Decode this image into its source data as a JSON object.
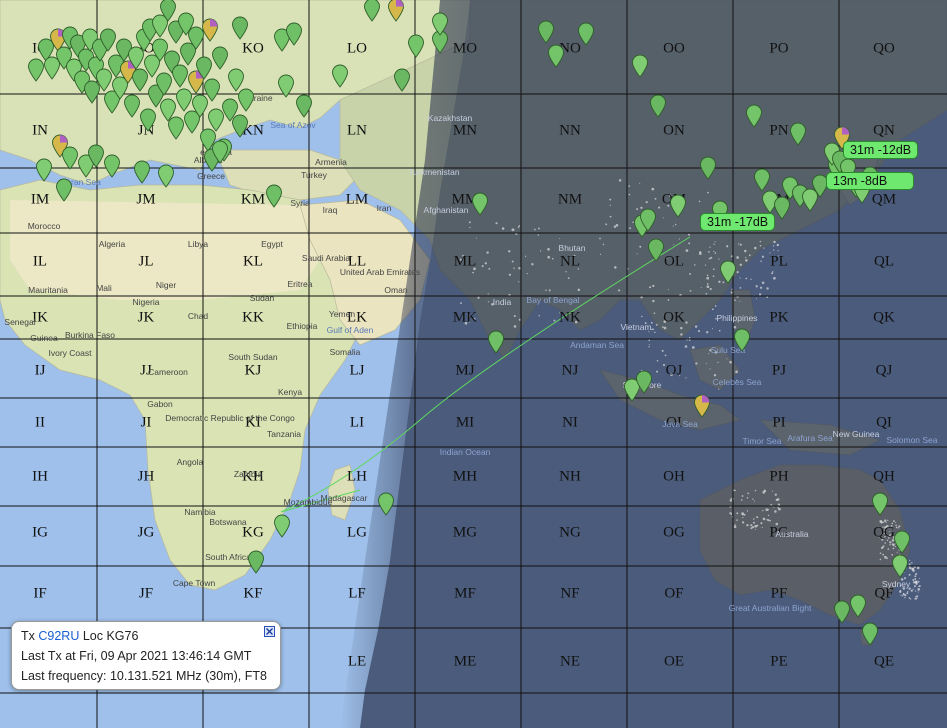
{
  "grid": {
    "columns": [
      "I",
      "J",
      "K",
      "L",
      "M",
      "N",
      "O",
      "P",
      "Q"
    ],
    "rows": [
      "O",
      "N",
      "M",
      "L",
      "K",
      "J",
      "I",
      "H",
      "G",
      "F",
      "E"
    ]
  },
  "places": {
    "ukraine": "Ukraine",
    "sea_of_azov": "Sea of Azov",
    "armenia": "Armenia",
    "kazakhstan": "Kazakhstan",
    "turkmenistan": "Turkmenistan",
    "greece": "Greece",
    "albania": "Albania",
    "turkey": "Turkey",
    "syria": "Syria",
    "iraq": "Iraq",
    "iran": "Iran",
    "afghanistan": "Afghanistan",
    "morocco": "Morocco",
    "algeria": "Algeria",
    "libya": "Libya",
    "egypt": "Egypt",
    "saudi_arabia": "Saudi Arabia",
    "uae": "United Arab Emirates",
    "oman": "Oman",
    "yemen": "Yemen",
    "mauritania": "Mauritania",
    "mali": "Mali",
    "niger": "Niger",
    "chad": "Chad",
    "sudan": "Sudan",
    "eritrea": "Eritrea",
    "ethiopia": "Ethiopia",
    "gulf_of_aden": "Gulf of Aden",
    "somalia": "Somalia",
    "senegal": "Senegal",
    "guinea": "Guinea",
    "burkina_faso": "Burkina Faso",
    "ivory_coast": "Ivory Coast",
    "nigeria": "Nigeria",
    "cameroon": "Cameroon",
    "south_sudan": "South Sudan",
    "kenya": "Kenya",
    "gabon": "Gabon",
    "drc": "Democratic Republic of the Congo",
    "tanzania": "Tanzania",
    "angola": "Angola",
    "zambia": "Zambia",
    "namibia": "Namibia",
    "botswana": "Botswana",
    "mozambique": "Mozambique",
    "madagascar": "Madagascar",
    "south_africa": "South Africa",
    "cape_town": "Cape Town",
    "india": "India",
    "indian_ocean": "Indian Ocean",
    "bhutan": "Bhutan",
    "bay_of_bengal": "Bay of Bengal",
    "andaman_sea": "Andaman Sea",
    "vietnam": "Vietnam",
    "philippines": "Philippines",
    "sulu_sea": "Sulu Sea",
    "singapore": "Singapore",
    "celebes_sea": "Celebes Sea",
    "java_sea": "Java Sea",
    "timor_sea": "Timor Sea",
    "arafura_sea": "Arafura Sea",
    "new_guinea": "New Guinea",
    "solomon_sea": "Solomon Sea",
    "australia": "Australia",
    "sydney": "Sydney",
    "great_australian_bight": "Great Australian Bight",
    "zhe_sea": "ean Sea",
    "boran_sea": "Iboran Sea"
  },
  "reports": [
    {
      "text": "31m -12dB"
    },
    {
      "text": "13m -8dB"
    },
    {
      "text": "31m -17dB"
    }
  ],
  "info_box": {
    "tx_prefix": "Tx ",
    "callsign": "C92RU",
    "loc_text": " Loc KG76",
    "last_tx": "Last Tx at Fri, 09 Apr 2021 13:46:14 GMT",
    "last_freq": "Last frequency: 10.131.521 MHz (30m), FT8"
  },
  "colors": {
    "ocean": "#9ec0ea",
    "land": "#dfe6c8",
    "night": "#2a3350",
    "marker": "#74c46a",
    "label": "#6ee86e",
    "path": "#58d758"
  }
}
